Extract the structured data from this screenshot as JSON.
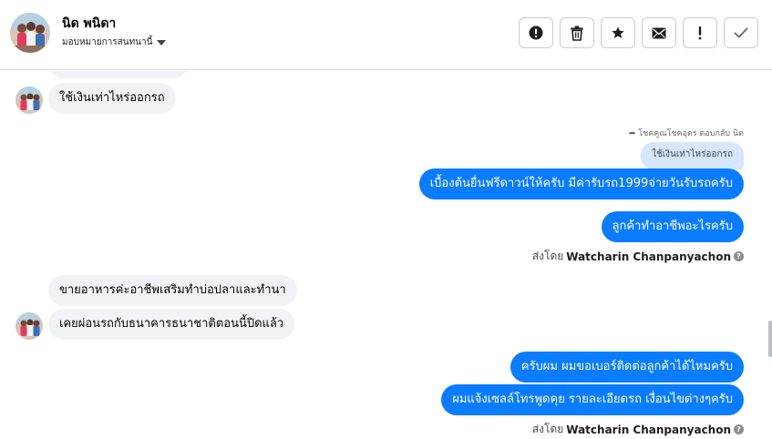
{
  "contact": {
    "name": "นิด พนิดา",
    "assign_label": "มอบหมายการสนทนานี้"
  },
  "actions": [
    {
      "name": "report-spam-button",
      "icon": "exclamation-circle-icon"
    },
    {
      "name": "delete-button",
      "icon": "trash-icon"
    },
    {
      "name": "star-button",
      "icon": "star-icon"
    },
    {
      "name": "mark-unread-button",
      "icon": "envelope-icon"
    },
    {
      "name": "follow-up-button",
      "icon": "exclamation-icon"
    },
    {
      "name": "mark-done-button",
      "icon": "checkmark-icon"
    }
  ],
  "messages": {
    "m1": "ใช้เงินเท่าไหร่ออกรถ",
    "reply_label": "โชคคูณโชคอุดร ตอบกลับ นิด",
    "quoted": "ใช้เงินเท่าไหร่ออกรถ",
    "m2": "เบื้องต้นยื่นฟรีดาวน์ให้ครับ มีค่ารับรถ1999จ่ายวันรับรถครับ",
    "m3": "ลูกค้าทำอาชีพอะไรครับ",
    "sent_by_prefix": "ส่งโดย",
    "sender": "Watcharin Chanpanyachon",
    "m4": "ขายอาหารค่ะอาชีพเสริมทำบ่อปลาและทำนา",
    "m5": "เคยผ่อนรถกับธนาคารธนาชาติตอนนี้ปิดแล้ว",
    "m6": "ครับผม ผมขอเบอร์ติดต่อลูกค้าได้ไหมครับ",
    "m7": "ผมแจ้งเซลล์โทรพูดคุย รายละเอียดรถ เงื่อนไขต่างๆครับ"
  },
  "colors": {
    "outgoing": "#0a7cff",
    "incoming": "#f0f2f5",
    "quoted": "#d6e6fb"
  }
}
